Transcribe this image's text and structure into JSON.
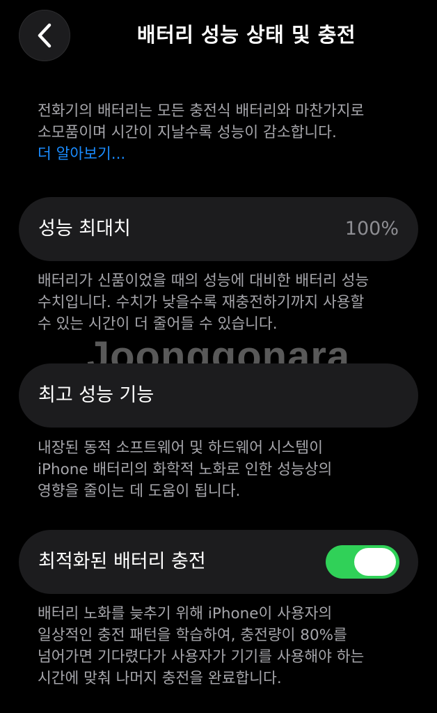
{
  "header": {
    "back_icon": "chevron-left-icon",
    "title": "배터리 성능 상태 및 충전"
  },
  "intro": {
    "lines": [
      "전화기의 배터리는 모든 충전식 배터리와 마찬가지로",
      "소모품이며 시간이 지날수록 성능이 감소합니다."
    ],
    "learn_more": "더 알아보기..."
  },
  "maximum_capacity": {
    "label": "성능 최대치",
    "value": "100%",
    "description": [
      "배터리가 신품이었을 때의 성능에 대비한 배터리 성능",
      "수치입니다. 수치가 낮을수록 재충전하기까지 사용할",
      "수 있는 시간이 더 줄어들 수 있습니다."
    ]
  },
  "peak_performance": {
    "label": "최고 성능 기능",
    "description": [
      "내장된 동적 소프트웨어 및 하드웨어 시스템이",
      "iPhone 배터리의 화학적 노화로 인한 성능상의",
      "영향을 줄이는 데 도움이 됩니다."
    ]
  },
  "optimized_charging": {
    "label": "최적화된 배터리 충전",
    "enabled": true,
    "description": [
      "배터리 노화를 늦추기 위해 iPhone이 사용자의",
      "일상적인 충전 패턴을 학습하여, 충전량이 80%를",
      "넘어가면 기다렸다가 사용자가 기기를 사용해야 하는",
      "시간에 맞춰 나머지 충전을 완료합니다."
    ]
  },
  "watermark": "Joonggonara",
  "colors": {
    "background": "#000000",
    "card": "#1c1c1e",
    "secondary_text": "#a6a6ab",
    "link": "#1a8cff",
    "toggle_on": "#30d158"
  }
}
